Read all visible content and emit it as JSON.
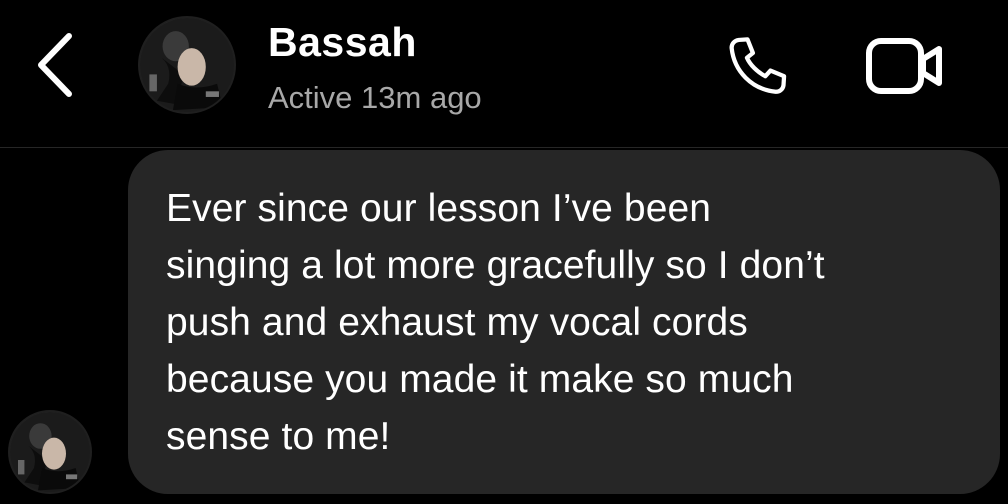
{
  "header": {
    "back_icon": "chevron-left-icon",
    "contact_name": "Bassah",
    "status": "Active 13m ago",
    "call_icon": "phone-icon",
    "video_icon": "video-camera-icon"
  },
  "thread": {
    "messages": [
      {
        "sender": "Bassah",
        "direction": "incoming",
        "text": "Ever since our lesson I’ve been\nsinging a lot more gracefully so I don’t\npush and exhaust my vocal cords\nbecause you made it make so much\nsense to me!"
      }
    ]
  },
  "colors": {
    "background": "#000000",
    "bubble": "#262626",
    "text": "#ffffff",
    "secondary_text": "#a8a8a8"
  }
}
